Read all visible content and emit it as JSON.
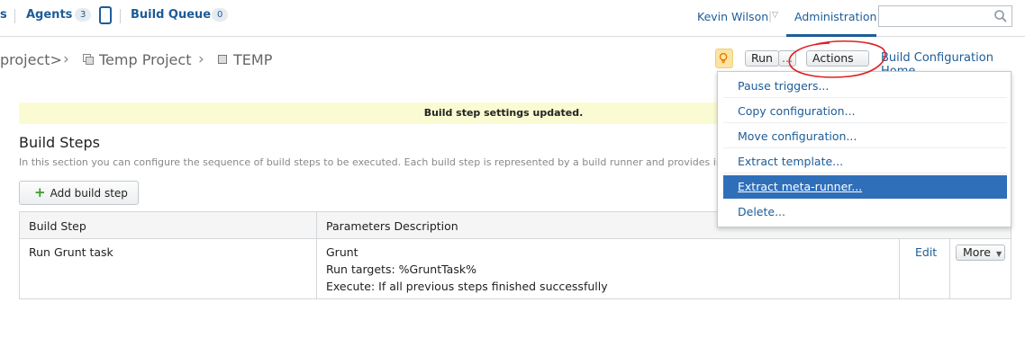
{
  "topnav": {
    "projects_partial": "s",
    "agents_label": "Agents",
    "agents_count": "3",
    "build_queue_label": "Build Queue",
    "build_queue_count": "0",
    "user_name": "Kevin Wilson",
    "admin_label": "Administration",
    "search_placeholder": ""
  },
  "breadcrumb": {
    "root_partial": "project>",
    "project": "Temp Project",
    "build_config": "TEMP"
  },
  "toolbar": {
    "run_label": "Run",
    "run_dropdown_label": "...",
    "actions_label": "Actions",
    "home_link": "Build Configuration Home"
  },
  "actions_menu": {
    "items": [
      {
        "label": "Pause triggers..."
      },
      {
        "label": "Copy configuration..."
      },
      {
        "label": "Move configuration..."
      },
      {
        "label": "Extract template..."
      },
      {
        "label": "Extract meta-runner..."
      },
      {
        "label": "Delete..."
      }
    ],
    "selected_index": 4
  },
  "message": "Build step settings updated.",
  "section": {
    "title": "Build Steps",
    "description": "In this section you can configure the sequence of build steps to be executed. Each build step is represented by a build runner and provides integ",
    "add_button": "Add build step"
  },
  "table": {
    "headers": [
      "Build Step",
      "Parameters Description"
    ],
    "rows": [
      {
        "name": "Run Grunt task",
        "param_lines": [
          "Grunt",
          "Run targets: %GruntTask%",
          "Execute: If all previous steps finished successfully"
        ],
        "edit_label": "Edit",
        "more_label": "More"
      }
    ]
  },
  "icons": {
    "search": "search-icon",
    "bulb": "lightbulb-icon",
    "copy": "copy-icon",
    "square": "build-config-icon",
    "plus": "plus-icon"
  },
  "colors": {
    "link": "#1d5c98",
    "highlight": "#2f6fb9",
    "message_bg": "#fbfbd3",
    "annotation": "#e02020"
  }
}
